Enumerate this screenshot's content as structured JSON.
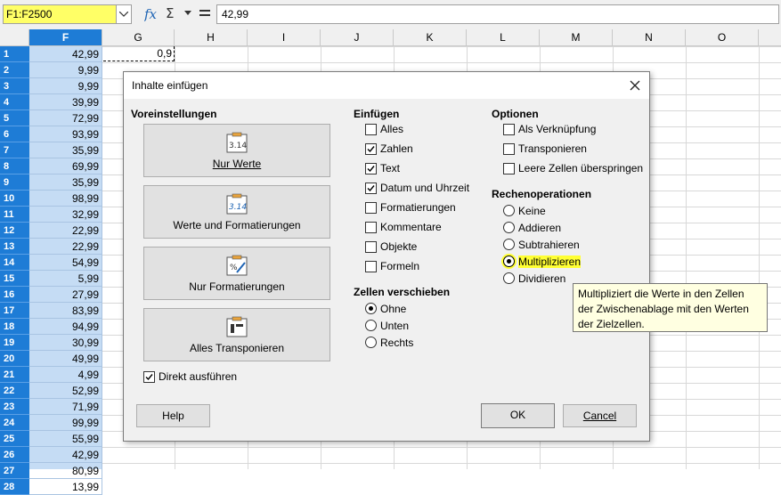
{
  "formula_bar": {
    "name_box": "F1:F2500",
    "formula_value": "42,99"
  },
  "columns": [
    "F",
    "G",
    "H",
    "I",
    "J",
    "K",
    "L",
    "M",
    "N",
    "O"
  ],
  "rows": [
    "1",
    "2",
    "3",
    "4",
    "5",
    "6",
    "7",
    "8",
    "9",
    "10",
    "11",
    "12",
    "13",
    "14",
    "15",
    "16",
    "17",
    "18",
    "19",
    "20",
    "21",
    "22",
    "23",
    "24",
    "25",
    "26",
    "27",
    "28"
  ],
  "f_values": [
    "42,99",
    "9,99",
    "9,99",
    "39,99",
    "72,99",
    "93,99",
    "35,99",
    "69,99",
    "35,99",
    "98,99",
    "32,99",
    "22,99",
    "22,99",
    "54,99",
    "5,99",
    "27,99",
    "83,99",
    "94,99",
    "30,99",
    "49,99",
    "4,99",
    "52,99",
    "71,99",
    "99,99",
    "55,99",
    "42,99",
    "80,99",
    "13,99"
  ],
  "g1_value": "0,9",
  "dialog": {
    "title": "Inhalte einfügen",
    "presets": {
      "heading": "Voreinstellungen",
      "buttons": [
        "Nur Werte",
        "Werte und Formatierungen",
        "Nur Formatierungen",
        "Alles Transponieren"
      ],
      "run_immediately": "Direkt ausführen"
    },
    "paste": {
      "heading": "Einfügen",
      "items": [
        {
          "label": "Alles",
          "checked": false
        },
        {
          "label": "Zahlen",
          "checked": true
        },
        {
          "label": "Text",
          "checked": true
        },
        {
          "label": "Datum und Uhrzeit",
          "checked": true
        },
        {
          "label": "Formatierungen",
          "checked": false
        },
        {
          "label": "Kommentare",
          "checked": false
        },
        {
          "label": "Objekte",
          "checked": false
        },
        {
          "label": "Formeln",
          "checked": false
        }
      ]
    },
    "shift_cells": {
      "heading": "Zellen verschieben",
      "items": [
        "Ohne",
        "Unten",
        "Rechts"
      ],
      "selected": "Ohne"
    },
    "options": {
      "heading": "Optionen",
      "items": [
        {
          "label": "Als Verknüpfung",
          "checked": false
        },
        {
          "label": "Transponieren",
          "checked": false
        },
        {
          "label": "Leere Zellen überspringen",
          "checked": false
        }
      ]
    },
    "operations": {
      "heading": "Rechenoperationen",
      "items": [
        "Keine",
        "Addieren",
        "Subtrahieren",
        "Multiplizieren",
        "Dividieren"
      ],
      "selected": "Multiplizieren"
    },
    "tooltip": "Multipliziert die Werte in den Zellen der Zwischenablage mit den Werten der Zielzellen.",
    "buttons": {
      "help": "Help",
      "ok": "OK",
      "cancel": "Cancel"
    }
  },
  "colors": {
    "selection": "#1e7cd6",
    "highlight": "#ffff33"
  }
}
